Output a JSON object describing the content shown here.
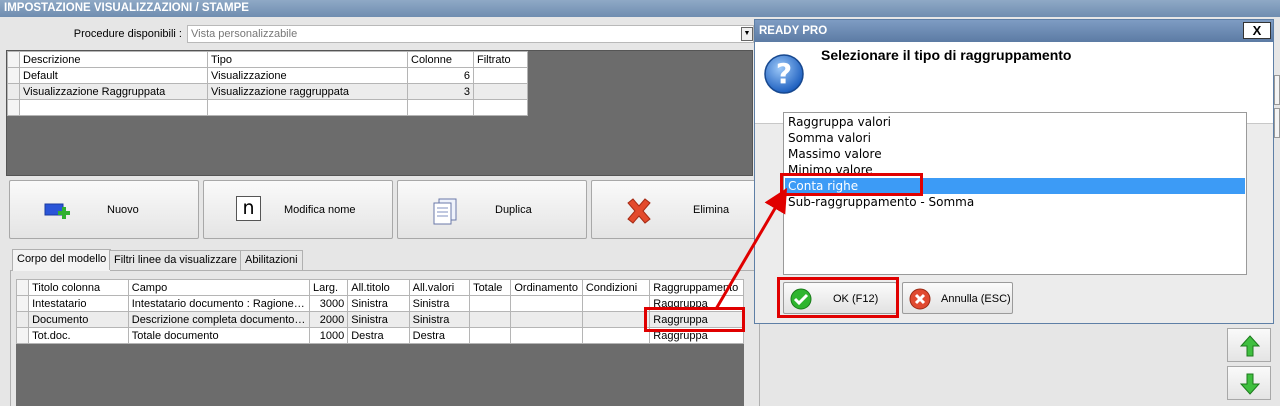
{
  "window": {
    "title": "IMPOSTAZIONE VISUALIZZAZIONI / STAMPE"
  },
  "procedures": {
    "label": "Procedure disponibili :",
    "selected": "Vista personalizzabile"
  },
  "proc_grid": {
    "headers": [
      "Descrizione",
      "Tipo",
      "Colonne",
      "Filtrato"
    ],
    "rows": [
      {
        "descrizione": "Default",
        "tipo": "Visualizzazione",
        "colonne": "6",
        "filtrato": ""
      },
      {
        "descrizione": "Visualizzazione Raggruppata",
        "tipo": "Visualizzazione raggruppata",
        "colonne": "3",
        "filtrato": ""
      }
    ]
  },
  "toolbar": {
    "nuovo": "Nuovo",
    "modifica": "Modifica nome",
    "duplica": "Duplica",
    "elimina": "Elimina",
    "n_glyph": "n"
  },
  "tabs": [
    "Corpo del modello",
    "Filtri linee da visualizzare",
    "Abilitazioni"
  ],
  "model_grid": {
    "headers": [
      "Titolo colonna",
      "Campo",
      "Larg.",
      "All.titolo",
      "All.valori",
      "Totale",
      "Ordinamento",
      "Condizioni",
      "Raggruppamento"
    ],
    "rows": [
      {
        "titolo": "Intestatario",
        "campo": "Intestatario documento : Ragione sociale",
        "larg": "3000",
        "all_titolo": "Sinistra",
        "all_valori": "Sinistra",
        "totale": "",
        "ordinamento": "",
        "condizioni": "",
        "raggruppamento": "Raggruppa"
      },
      {
        "titolo": "Documento",
        "campo": "Descrizione completa documento (tipo, numero, data)",
        "larg": "2000",
        "all_titolo": "Sinistra",
        "all_valori": "Sinistra",
        "totale": "",
        "ordinamento": "",
        "condizioni": "",
        "raggruppamento": "Raggruppa"
      },
      {
        "titolo": "Tot.doc.",
        "campo": "Totale documento",
        "larg": "1000",
        "all_titolo": "Destra",
        "all_valori": "Destra",
        "totale": "",
        "ordinamento": "",
        "condizioni": "",
        "raggruppamento": "Raggruppa"
      }
    ]
  },
  "dialog": {
    "title": "READY PRO",
    "close": "X",
    "question_mark": "?",
    "heading": "Selezionare il tipo di raggruppamento",
    "options": [
      "Raggruppa valori",
      "Somma valori",
      "Massimo valore",
      "Minimo valore",
      "Conta righe",
      "Sub-raggruppamento - Somma"
    ],
    "selected_option": "Conta righe",
    "ok": "OK (F12)",
    "cancel": "Annulla (ESC)"
  },
  "colors": {
    "highlight": "#e00000",
    "selection": "#3c9bf6",
    "title_bar": "#7e9cc3"
  }
}
